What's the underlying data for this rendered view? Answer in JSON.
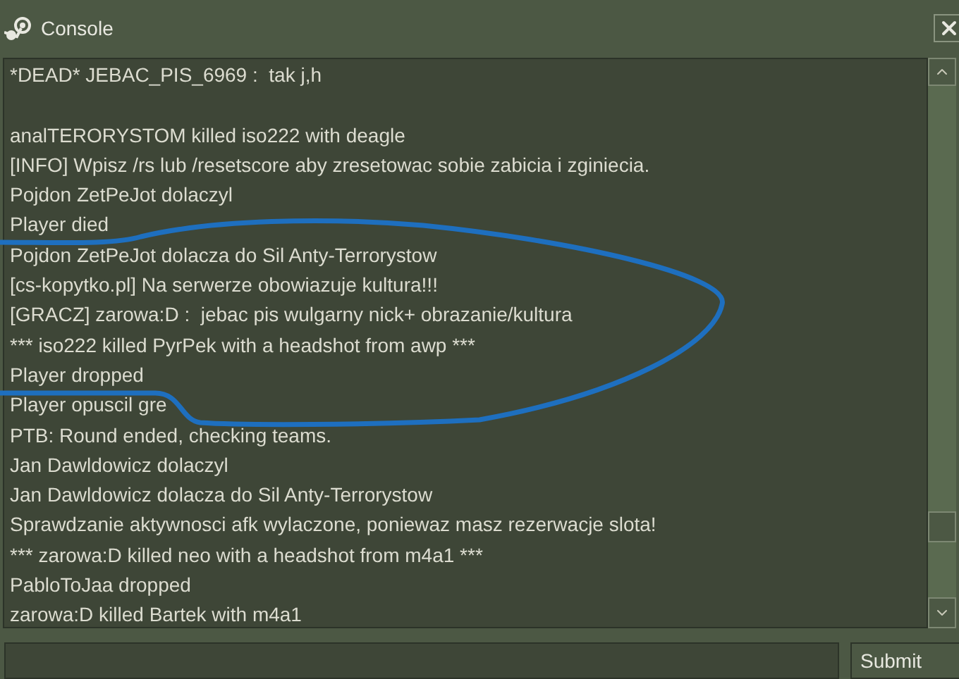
{
  "window": {
    "title": "Console"
  },
  "log": [
    {
      "kind": "text",
      "text": "*DEAD* JEBAC_PIS_6969 :  tak j,h"
    },
    {
      "kind": "blank"
    },
    {
      "kind": "text",
      "text": "analTERORYSTOM killed iso222 with deagle"
    },
    {
      "kind": "text",
      "text": "[INFO] Wpisz /rs lub /resetscore aby zresetowac sobie zabicia i zginiecia."
    },
    {
      "kind": "text",
      "text": "Pojdon ZetPeJot dolaczyl"
    },
    {
      "kind": "text",
      "text": "Player died"
    },
    {
      "kind": "text",
      "text": "Pojdon ZetPeJot dolacza do Sil Anty-Terrorystow"
    },
    {
      "kind": "text",
      "text": "[cs-kopytko.pl] Na serwerze obowiazuje kultura!!!"
    },
    {
      "kind": "text",
      "text": "[GRACZ] zarowa:D :  jebac pis wulgarny nick+ obrazanie/kultura"
    },
    {
      "kind": "text",
      "text": "*** iso222 killed PyrPek with a headshot from awp ***"
    },
    {
      "kind": "text",
      "text": "Player dropped"
    },
    {
      "kind": "text",
      "text": "Player opuscil gre"
    },
    {
      "kind": "text",
      "text": "PTB: Round ended, checking teams."
    },
    {
      "kind": "text",
      "text": "Jan Dawldowicz dolaczyl"
    },
    {
      "kind": "text",
      "text": "Jan Dawldowicz dolacza do Sil Anty-Terrorystow"
    },
    {
      "kind": "text",
      "text": "Sprawdzanie aktywnosci afk wylaczone, poniewaz masz rezerwacje slota!"
    },
    {
      "kind": "text",
      "text": "*** zarowa:D killed neo with a headshot from m4a1 ***"
    },
    {
      "kind": "text",
      "text": "PabloToJaa dropped"
    },
    {
      "kind": "text",
      "text": "zarowa:D killed Bartek with m4a1"
    }
  ],
  "submit_button": {
    "label": "Submit"
  }
}
